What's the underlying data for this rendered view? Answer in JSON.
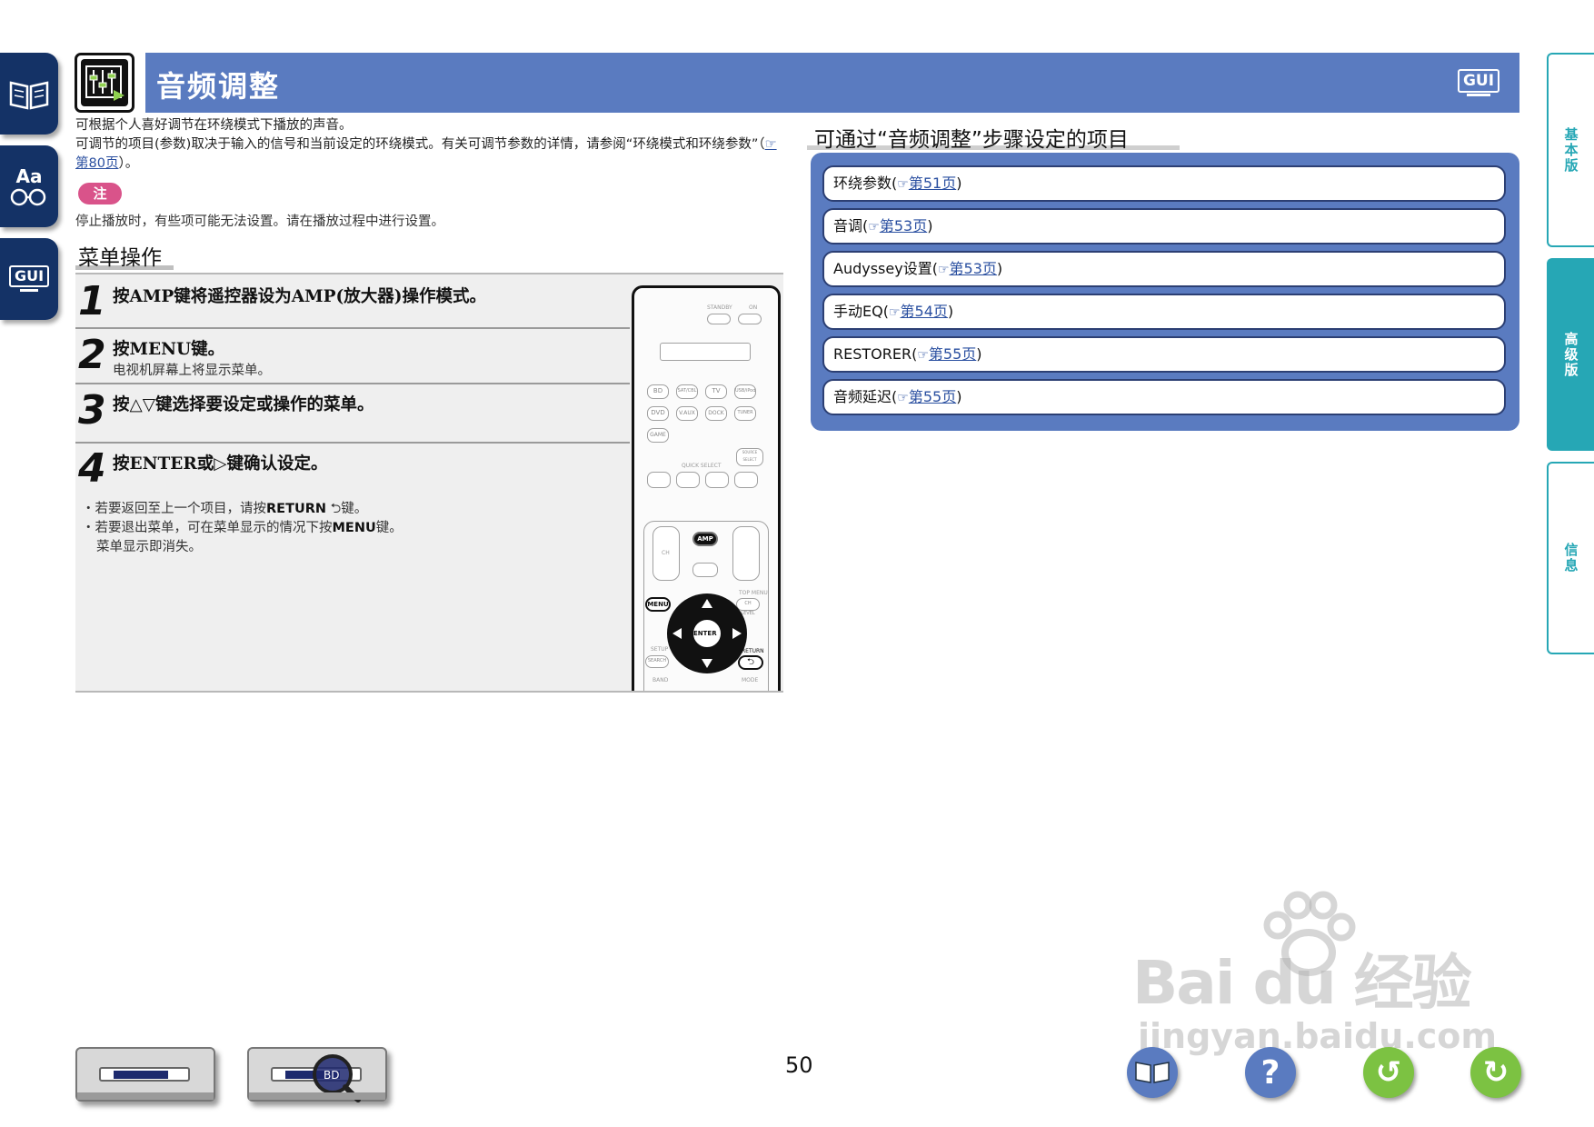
{
  "nav_left": [
    {
      "label": "目录",
      "icon": "book-icon"
    },
    {
      "label": "Aa",
      "icon": "glossary-icon"
    },
    {
      "label": "GUI",
      "icon": "gui-icon"
    }
  ],
  "header": {
    "title": "音频调整",
    "badge": "GUI",
    "icon": "audio-adjust-icon"
  },
  "intro": {
    "line1": "可根据个人喜好调节在环绕模式下播放的声音。",
    "line2a": "可调节的项目(参数)取决于输入的信号和当前设定的环绕模式。有关可调节参数的详情，请参阅“环绕模式和环绕参数”（",
    "line2_link": "第80页",
    "line2b": "）。"
  },
  "note": {
    "label": "注",
    "text": "停止播放时，有些项可能无法设置。请在播放过程中进行设置。"
  },
  "menu_section": {
    "title": "菜单操作",
    "steps": [
      {
        "num": "1",
        "text": "按AMP键将遥控器设为AMP(放大器)操作模式。",
        "sub": ""
      },
      {
        "num": "2",
        "text": "按MENU键。",
        "sub": "电视机屏幕上将显示菜单。"
      },
      {
        "num": "3",
        "text": "按△▽键选择要设定或操作的菜单。",
        "sub": ""
      },
      {
        "num": "4",
        "text": "按ENTER或▷键确认设定。",
        "sub": ""
      }
    ],
    "bullet1_pre": "若要返回至上一个项目，请按",
    "bullet1_key": "RETURN",
    "bullet1_post": "键。",
    "bullet2_pre": "若要退出菜单，可在菜单显示的情况下按",
    "bullet2_key": "MENU",
    "bullet2_post": "键。",
    "bullet2_cont": "菜单显示即消失。"
  },
  "remote": {
    "standby": "STANDBY",
    "on": "ON",
    "row1": [
      "BD",
      "SAT/CBL",
      "TV",
      "USB/iPod"
    ],
    "row2": [
      "DVD",
      "V.AUX",
      "DOCK",
      "TUNER"
    ],
    "row3": [
      "GAME"
    ],
    "source_select": "SOURCE SELECT",
    "quick_select": "QUICK SELECT",
    "amp": "AMP",
    "ch": "CH",
    "menu": "MENU",
    "enter": "ENTER",
    "return": "RETURN",
    "top_menu": "TOP MENU",
    "ch_level": "CH LEVEL",
    "setup": "SETUP",
    "search": "SEARCH",
    "band": "BAND",
    "mode": "MODE"
  },
  "right_section": {
    "title": "可通过“音频调整”步骤设定的项目",
    "items": [
      {
        "label": "环绕参数",
        "page": "第51页"
      },
      {
        "label": "音调",
        "page": "第53页"
      },
      {
        "label": "Audyssey设置",
        "page": "第53页"
      },
      {
        "label": "手动EQ",
        "page": "第54页"
      },
      {
        "label": "RESTORER",
        "page": "第55页"
      },
      {
        "label": "音频延迟",
        "page": "第55页"
      }
    ]
  },
  "nav_right": [
    {
      "label": "基本版"
    },
    {
      "label": "高级版",
      "active": true
    },
    {
      "label": "信息"
    }
  ],
  "footer": {
    "page_number": "50",
    "buttons": [
      "book-icon",
      "help-icon",
      "back-icon",
      "forward-icon"
    ],
    "device_display": "BD"
  },
  "watermark": {
    "brand": "Bai du 经验",
    "url": "jingyan.baidu.com"
  },
  "colors": {
    "header_blue": "#5a7bc0",
    "nav_dark_blue": "#143266",
    "teal": "#26a7b5",
    "note_pink": "#d9538a",
    "link_blue": "#2a4fa0"
  }
}
